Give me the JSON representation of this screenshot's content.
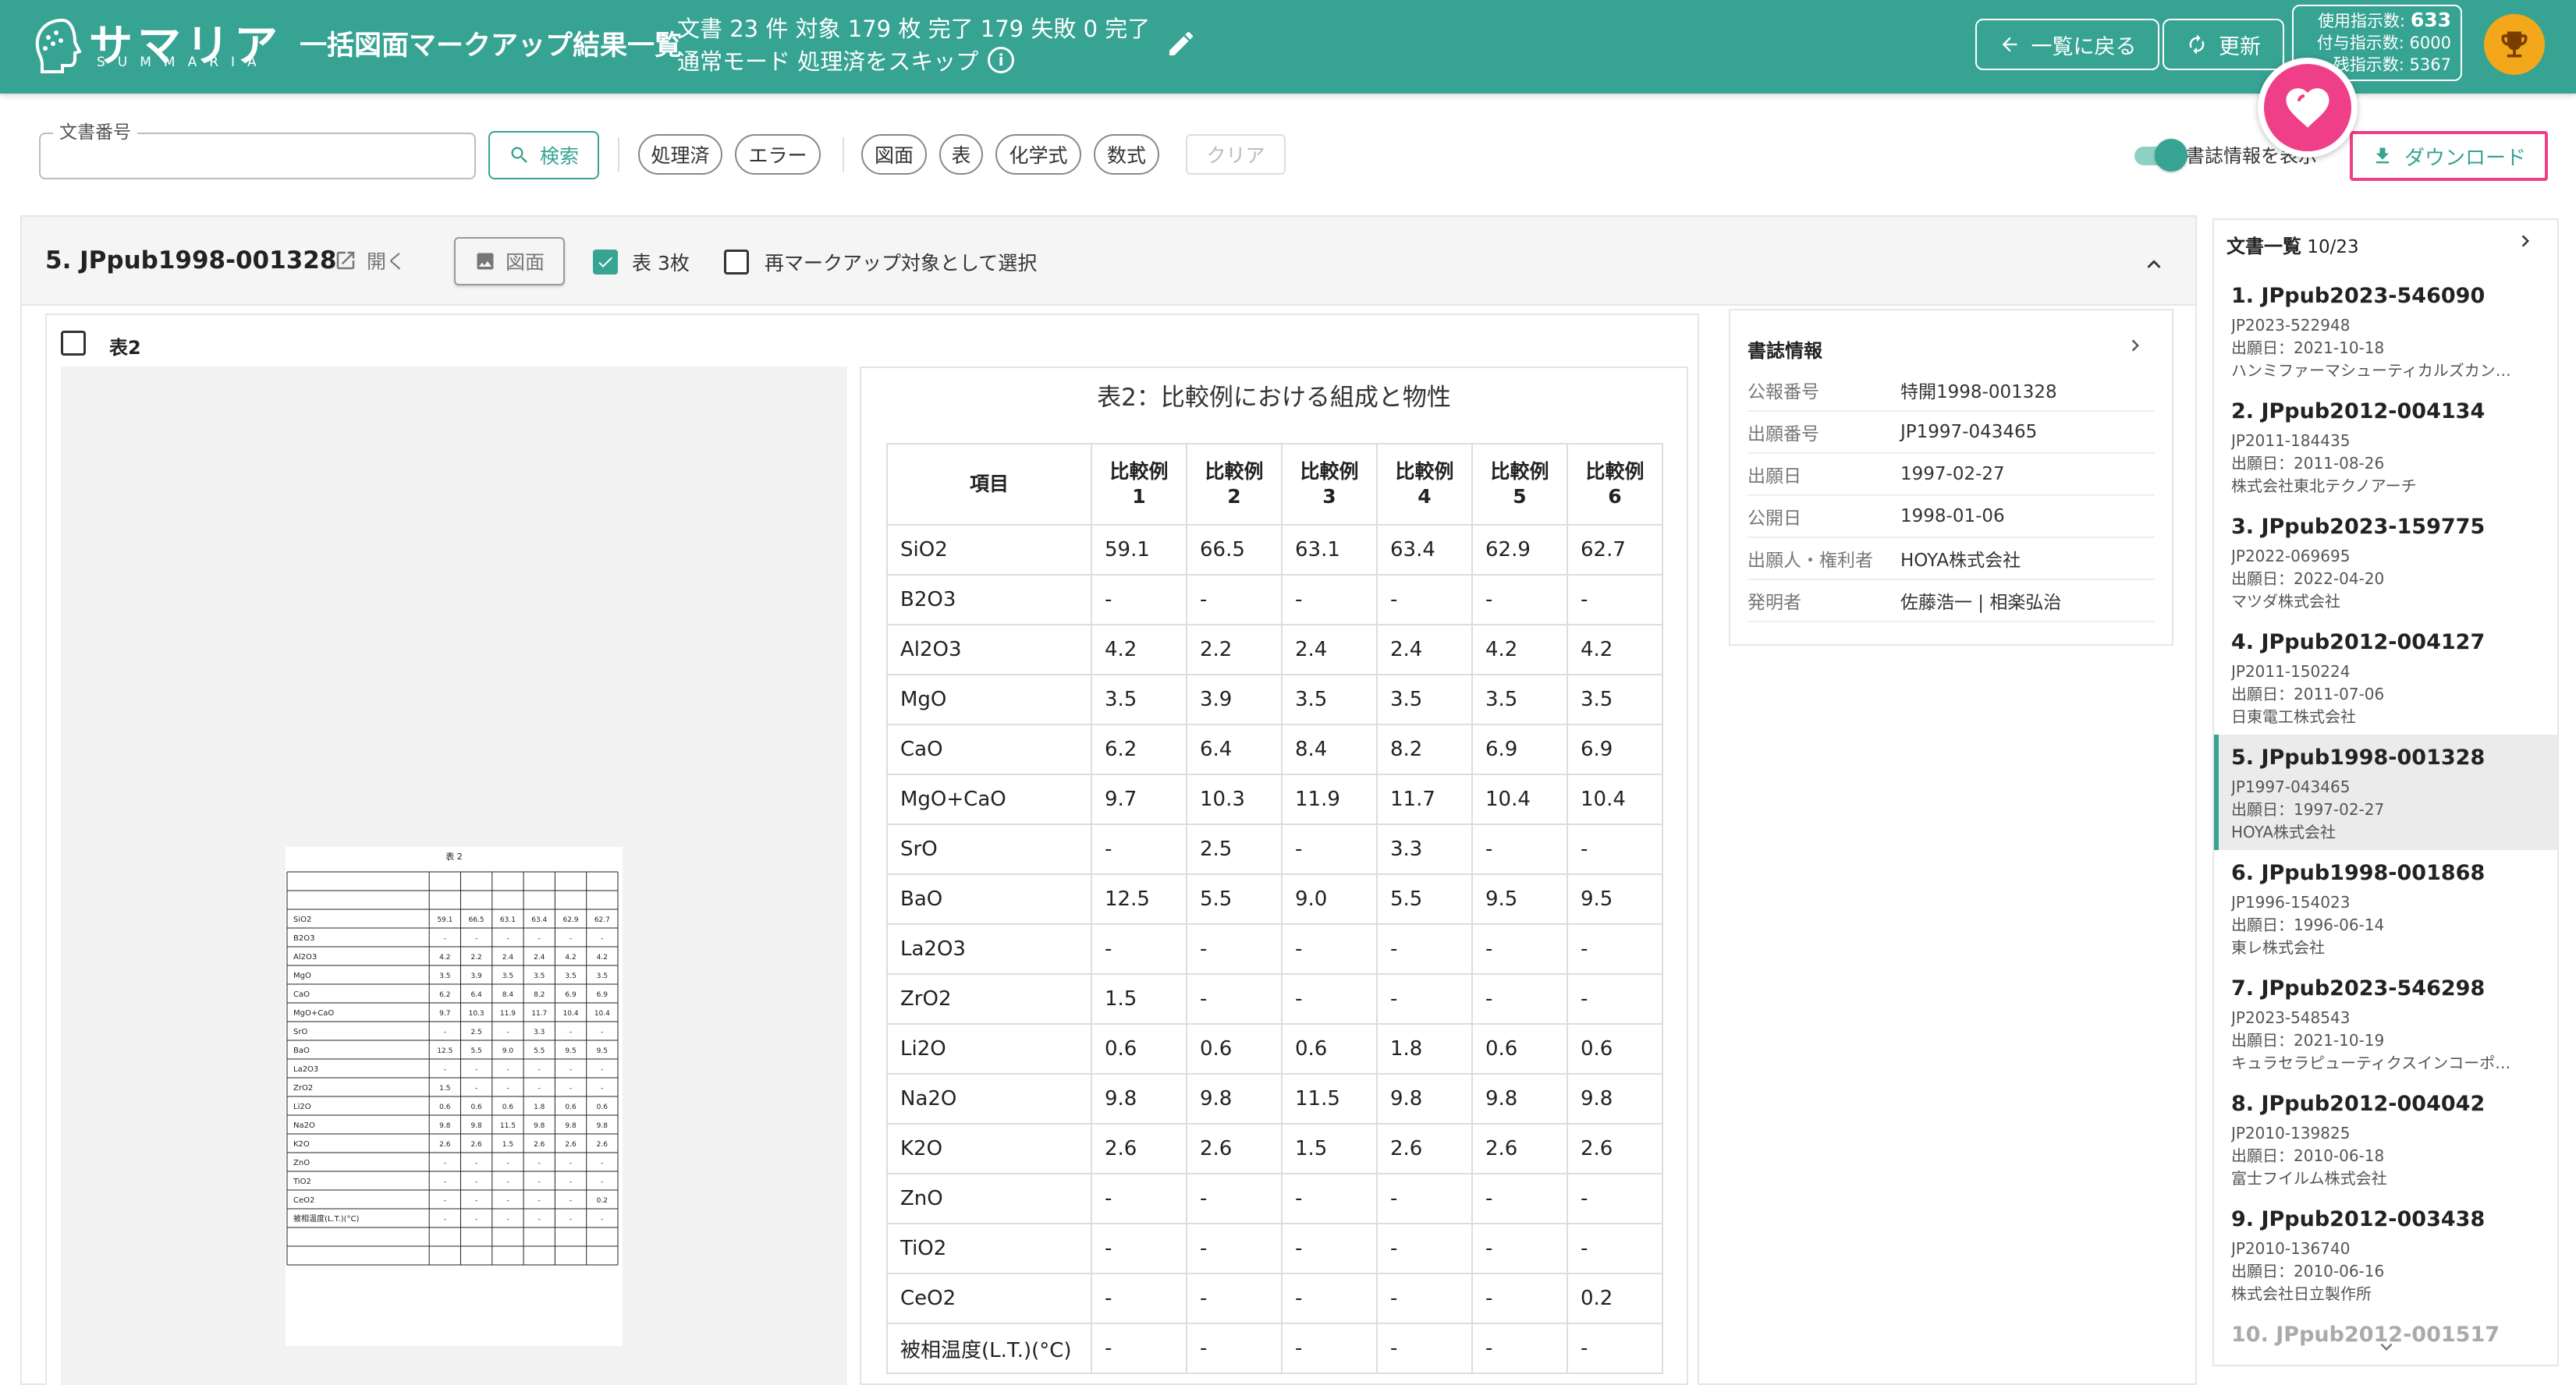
{
  "header": {
    "logo_text": "サマリア",
    "logo_sub": "SUMMARIA",
    "title": "一括図面マークアップ結果一覧",
    "stats_line1": "文書 23 件 対象 179 枚 完了 179 失敗 0  完了",
    "stats_line2": "通常モード 処理済をスキップ",
    "info_symbol": "i",
    "back_label": "一覧に戻る",
    "refresh_label": "更新",
    "quota": {
      "used_label": "使用指示数:",
      "used_value": "633",
      "granted": "付与指示数: 6000",
      "remaining": "残指示数: 5367"
    },
    "colors": {
      "header_bg": "#36a393",
      "accent_pink": "#ef3f88",
      "trophy": "#f3a71b"
    }
  },
  "filters": {
    "doc_number_label": "文書番号",
    "doc_number_value": "",
    "search_label": "検索",
    "status_chips": [
      "処理済",
      "エラー"
    ],
    "type_chips": [
      "図面",
      "表",
      "化学式",
      "数式"
    ],
    "clear_label": "クリア",
    "show_biblio_label": "書誌情報を表示",
    "show_biblio_on": true,
    "download_label": "ダウンロード"
  },
  "document": {
    "title": "5. JPpub1998-001328",
    "open_label": "開く",
    "figure_label": "図面",
    "table_count_label": "表 3枚",
    "table_count_checked": true,
    "remarkup_label": "再マークアップ対象として選択",
    "table_card_label": "表2",
    "scan_caption": "表 2",
    "table": {
      "caption": "表2：比較例における組成と物性",
      "item_header": "項目",
      "columns": [
        [
          "比較例",
          "1"
        ],
        [
          "比較例",
          "2"
        ],
        [
          "比較例",
          "3"
        ],
        [
          "比較例",
          "4"
        ],
        [
          "比較例",
          "5"
        ],
        [
          "比較例",
          "6"
        ]
      ],
      "rows": [
        {
          "item": "SiO2",
          "values": [
            "59.1",
            "66.5",
            "63.1",
            "63.4",
            "62.9",
            "62.7"
          ]
        },
        {
          "item": "B2O3",
          "values": [
            "-",
            "-",
            "-",
            "-",
            "-",
            "-"
          ]
        },
        {
          "item": "Al2O3",
          "values": [
            "4.2",
            "2.2",
            "2.4",
            "2.4",
            "4.2",
            "4.2"
          ]
        },
        {
          "item": "MgO",
          "values": [
            "3.5",
            "3.9",
            "3.5",
            "3.5",
            "3.5",
            "3.5"
          ]
        },
        {
          "item": "CaO",
          "values": [
            "6.2",
            "6.4",
            "8.4",
            "8.2",
            "6.9",
            "6.9"
          ]
        },
        {
          "item": "MgO+CaO",
          "values": [
            "9.7",
            "10.3",
            "11.9",
            "11.7",
            "10.4",
            "10.4"
          ]
        },
        {
          "item": "SrO",
          "values": [
            "-",
            "2.5",
            "-",
            "3.3",
            "-",
            "-"
          ]
        },
        {
          "item": "BaO",
          "values": [
            "12.5",
            "5.5",
            "9.0",
            "5.5",
            "9.5",
            "9.5"
          ]
        },
        {
          "item": "La2O3",
          "values": [
            "-",
            "-",
            "-",
            "-",
            "-",
            "-"
          ]
        },
        {
          "item": "ZrO2",
          "values": [
            "1.5",
            "-",
            "-",
            "-",
            "-",
            "-"
          ]
        },
        {
          "item": "Li2O",
          "values": [
            "0.6",
            "0.6",
            "0.6",
            "1.8",
            "0.6",
            "0.6"
          ]
        },
        {
          "item": "Na2O",
          "values": [
            "9.8",
            "9.8",
            "11.5",
            "9.8",
            "9.8",
            "9.8"
          ]
        },
        {
          "item": "K2O",
          "values": [
            "2.6",
            "2.6",
            "1.5",
            "2.6",
            "2.6",
            "2.6"
          ]
        },
        {
          "item": "ZnO",
          "values": [
            "-",
            "-",
            "-",
            "-",
            "-",
            "-"
          ]
        },
        {
          "item": "TiO2",
          "values": [
            "-",
            "-",
            "-",
            "-",
            "-",
            "-"
          ]
        },
        {
          "item": "CeO2",
          "values": [
            "-",
            "-",
            "-",
            "-",
            "-",
            "0.2"
          ]
        },
        {
          "item": "被相温度(L.T.)(°C)",
          "values": [
            "-",
            "-",
            "-",
            "-",
            "-",
            "-"
          ]
        }
      ]
    }
  },
  "biblio": {
    "title": "書誌情報",
    "rows": [
      {
        "k": "公報番号",
        "v": "特開1998-001328"
      },
      {
        "k": "出願番号",
        "v": "JP1997-043465"
      },
      {
        "k": "出願日",
        "v": "1997-02-27"
      },
      {
        "k": "公開日",
        "v": "1998-01-06"
      },
      {
        "k": "出願人・権利者",
        "v": "HOYA株式会社"
      },
      {
        "k": "発明者",
        "v": "佐藤浩一 | 相楽弘治"
      }
    ]
  },
  "doc_list": {
    "title": "文書一覧",
    "count": "10/23",
    "items": [
      {
        "t": "1. JPpub2023-546090",
        "a": "JP2023-522948",
        "d": "出願日：2021-10-18",
        "c": "ハンミファーマシューティカルズカン…"
      },
      {
        "t": "2. JPpub2012-004134",
        "a": "JP2011-184435",
        "d": "出願日：2011-08-26",
        "c": "株式会社東北テクノアーチ"
      },
      {
        "t": "3. JPpub2023-159775",
        "a": "JP2022-069695",
        "d": "出願日：2022-04-20",
        "c": "マツダ株式会社"
      },
      {
        "t": "4. JPpub2012-004127",
        "a": "JP2011-150224",
        "d": "出願日：2011-07-06",
        "c": "日東電工株式会社"
      },
      {
        "t": "5. JPpub1998-001328",
        "a": "JP1997-043465",
        "d": "出願日：1997-02-27",
        "c": "HOYA株式会社"
      },
      {
        "t": "6. JPpub1998-001868",
        "a": "JP1996-154023",
        "d": "出願日：1996-06-14",
        "c": "東レ株式会社"
      },
      {
        "t": "7. JPpub2023-546298",
        "a": "JP2023-548543",
        "d": "出願日：2021-10-19",
        "c": "キュラセラピューティクスインコーポ…"
      },
      {
        "t": "8. JPpub2012-004042",
        "a": "JP2010-139825",
        "d": "出願日：2010-06-18",
        "c": "富士フイルム株式会社"
      },
      {
        "t": "9. JPpub2012-003438",
        "a": "JP2010-136740",
        "d": "出願日：2010-06-16",
        "c": "株式会社日立製作所"
      },
      {
        "t": "10. JPpub2012-001517",
        "a": "",
        "d": "",
        "c": ""
      }
    ],
    "selected_index": 4
  }
}
